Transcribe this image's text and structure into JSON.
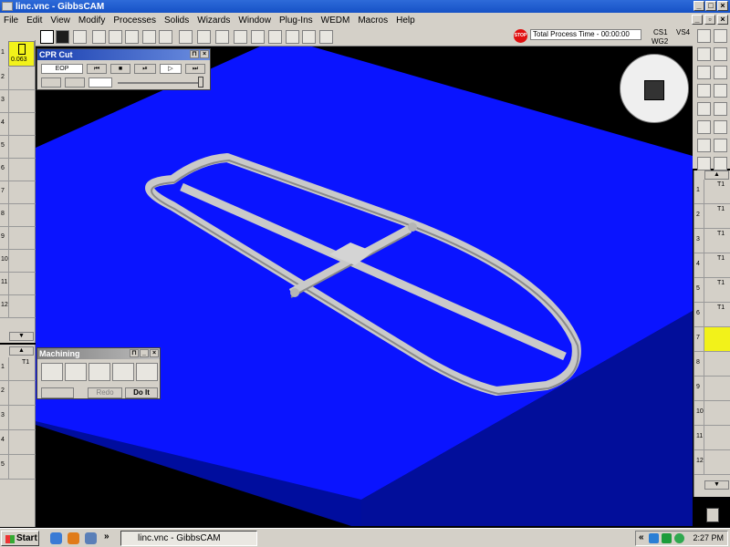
{
  "window": {
    "title": "linc.vnc - GibbsCAM"
  },
  "menu": [
    "File",
    "Edit",
    "View",
    "Modify",
    "Processes",
    "Solids",
    "Wizards",
    "Window",
    "Plug-Ins",
    "WEDM",
    "Macros",
    "Help"
  ],
  "status": {
    "stop_label": "STOP",
    "process_time": "Total Process Time - 00:00:00",
    "cs": "CS1",
    "vs": "VS4",
    "wg": "WG2"
  },
  "tool_list": {
    "first_tool_diameter": "0.063",
    "slot_numbers": [
      "1",
      "2",
      "3",
      "4",
      "5",
      "6",
      "7",
      "8",
      "9",
      "10",
      "11",
      "12"
    ]
  },
  "op_list_left": {
    "slot_numbers": [
      "1",
      "2",
      "3",
      "4",
      "5"
    ],
    "t1_label": "T1"
  },
  "cpr_palette": {
    "title": "CPR Cut",
    "eop_label": "EOP",
    "pin_label": "⊓",
    "close_label": "×"
  },
  "machining_palette": {
    "title": "Machining",
    "redo_label": "Redo",
    "do_it_label": "Do It"
  },
  "right_ops": {
    "slot_numbers": [
      "1",
      "2",
      "3",
      "4",
      "5",
      "6",
      "7",
      "8",
      "9",
      "10",
      "11",
      "12"
    ],
    "t1_label": "T1",
    "highlight_color": "#f2f21a"
  },
  "taskbar": {
    "start_label": "Start",
    "task_label": "linc.vnc - GibbsCAM",
    "more_label": "»",
    "tray_more": "«",
    "clock": "2:27 PM"
  },
  "colors": {
    "stock_top": "#0a14ff",
    "stock_side": "#000d9e",
    "part": "#c9c9c9",
    "title_bar": "#1651c6"
  }
}
